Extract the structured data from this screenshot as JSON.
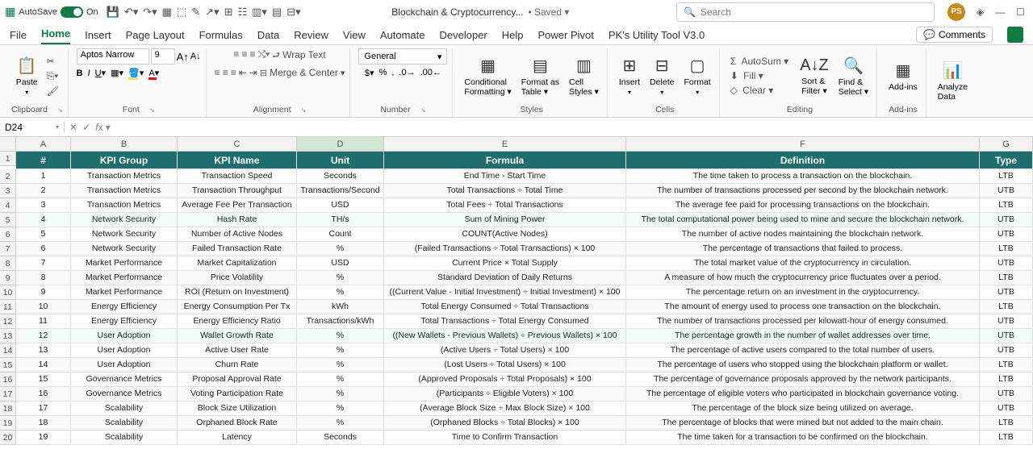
{
  "titlebar": {
    "autosave_label": "AutoSave",
    "autosave_on": "On",
    "filename": "Blockchain & Cryptocurrency...",
    "saved_label": "• Saved ▾",
    "search_placeholder": "Search",
    "avatar_initials": "PS"
  },
  "tabs": [
    "File",
    "Home",
    "Insert",
    "Page Layout",
    "Formulas",
    "Data",
    "Review",
    "View",
    "Automate",
    "Developer",
    "Help",
    "Power Pivot",
    "PK's Utility Tool V3.0"
  ],
  "active_tab": "Home",
  "comments_label": "Comments",
  "ribbon": {
    "clipboard": "Clipboard",
    "paste": "Paste",
    "font_group": "Font",
    "font_name": "Aptos Narrow",
    "font_size": "9",
    "alignment": "Alignment",
    "wrap": "Wrap Text",
    "merge": "Merge & Center",
    "number": "Number",
    "number_format": "General",
    "styles": "Styles",
    "cond_fmt": "Conditional\nFormatting ▾",
    "fmt_table": "Format as\nTable ▾",
    "cell_styles": "Cell\nStyles ▾",
    "cells": "Cells",
    "insert": "Insert",
    "delete": "Delete",
    "format": "Format",
    "editing": "Editing",
    "autosum": "AutoSum ▾",
    "fill": "Fill ▾",
    "clear": "Clear ▾",
    "sort": "Sort &\nFilter ▾",
    "find": "Find &\nSelect ▾",
    "addins": "Add-ins",
    "analyze": "Analyze\nData"
  },
  "namebox": "D24",
  "columns": [
    "A",
    "B",
    "C",
    "D",
    "E",
    "F",
    "G"
  ],
  "headers": [
    "#",
    "KPI Group",
    "KPI Name",
    "Unit",
    "Formula",
    "Definition",
    "Type"
  ],
  "rows": [
    [
      "1",
      "Transaction Metrics",
      "Transaction Speed",
      "Seconds",
      "End Time - Start Time",
      "The time taken to process a transaction on the blockchain.",
      "LTB"
    ],
    [
      "2",
      "Transaction Metrics",
      "Transaction Throughput",
      "Transactions/Second",
      "Total Transactions ÷ Total Time",
      "The number of transactions processed per second by the blockchain network.",
      "UTB"
    ],
    [
      "3",
      "Transaction Metrics",
      "Average Fee Per Transaction",
      "USD",
      "Total Fees ÷ Total Transactions",
      "The average fee paid for processing transactions on the blockchain.",
      "LTB"
    ],
    [
      "4",
      "Network Security",
      "Hash Rate",
      "TH/s",
      "Sum of Mining Power",
      "The total computational power being used to mine and secure the blockchain network.",
      "UTB"
    ],
    [
      "5",
      "Network Security",
      "Number of Active Nodes",
      "Count",
      "COUNT(Active Nodes)",
      "The number of active nodes maintaining the blockchain network.",
      "UTB"
    ],
    [
      "6",
      "Network Security",
      "Failed Transaction Rate",
      "%",
      "(Failed Transactions ÷ Total Transactions) × 100",
      "The percentage of transactions that failed to process.",
      "LTB"
    ],
    [
      "7",
      "Market Performance",
      "Market Capitalization",
      "USD",
      "Current Price × Total Supply",
      "The total market value of the cryptocurrency in circulation.",
      "UTB"
    ],
    [
      "8",
      "Market Performance",
      "Price Volatility",
      "%",
      "Standard Deviation of Daily Returns",
      "A measure of how much the cryptocurrency price fluctuates over a period.",
      "LTB"
    ],
    [
      "9",
      "Market Performance",
      "ROI (Return on Investment)",
      "%",
      "((Current Value - Initial Investment) ÷ Initial Investment) × 100",
      "The percentage return on an investment in the cryptocurrency.",
      "UTB"
    ],
    [
      "10",
      "Energy Efficiency",
      "Energy Consumption Per Tx",
      "kWh",
      "Total Energy Consumed ÷ Total Transactions",
      "The amount of energy used to process one transaction on the blockchain.",
      "LTB"
    ],
    [
      "11",
      "Energy Efficiency",
      "Energy Efficiency Ratio",
      "Transactions/kWh",
      "Total Transactions ÷ Total Energy Consumed",
      "The number of transactions processed per kilowatt-hour of energy consumed.",
      "UTB"
    ],
    [
      "12",
      "User Adoption",
      "Wallet Growth Rate",
      "%",
      "((New Wallets - Previous Wallets) ÷ Previous Wallets) × 100",
      "The percentage growth in the number of wallet addresses over time.",
      "UTB"
    ],
    [
      "13",
      "User Adoption",
      "Active User Rate",
      "%",
      "(Active Users ÷ Total Users) × 100",
      "The percentage of active users compared to the total number of users.",
      "UTB"
    ],
    [
      "14",
      "User Adoption",
      "Churn Rate",
      "%",
      "(Lost Users ÷ Total Users) × 100",
      "The percentage of users who stopped using the blockchain platform or wallet.",
      "LTB"
    ],
    [
      "15",
      "Governance Metrics",
      "Proposal Approval Rate",
      "%",
      "(Approved Proposals ÷ Total Proposals) × 100",
      "The percentage of governance proposals approved by the network participants.",
      "LTB"
    ],
    [
      "16",
      "Governance Metrics",
      "Voting Participation Rate",
      "%",
      "(Participants ÷ Eligible Voters) × 100",
      "The percentage of eligible voters who participated in blockchain governance voting.",
      "UTB"
    ],
    [
      "17",
      "Scalability",
      "Block Size Utilization",
      "%",
      "(Average Block Size ÷ Max Block Size) × 100",
      "The percentage of the block size being utilized on average.",
      "UTB"
    ],
    [
      "18",
      "Scalability",
      "Orphaned Block Rate",
      "%",
      "(Orphaned Blocks ÷ Total Blocks) × 100",
      "The percentage of blocks that were mined but not added to the main chain.",
      "LTB"
    ],
    [
      "19",
      "Scalability",
      "Latency",
      "Seconds",
      "Time to Confirm Transaction",
      "The time taken for a transaction to be confirmed on the blockchain.",
      "LTB"
    ]
  ]
}
